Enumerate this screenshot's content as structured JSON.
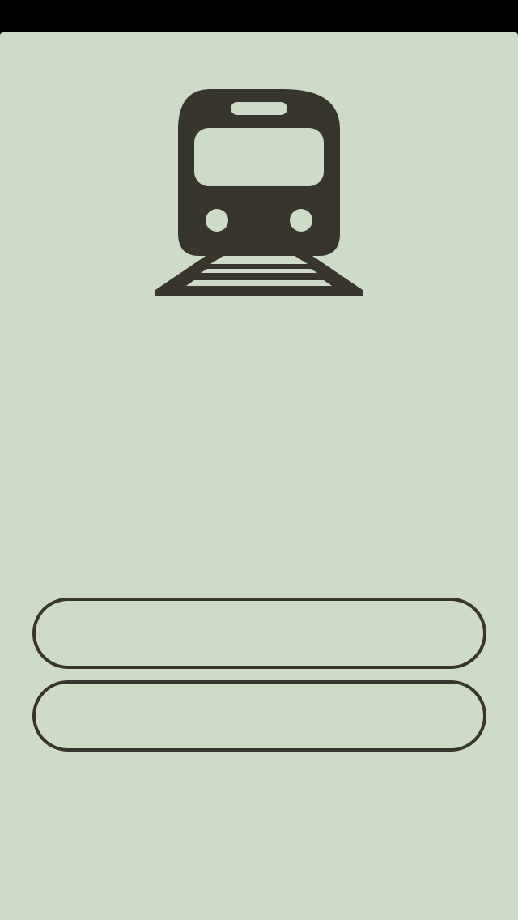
{
  "colors": {
    "status_bar": "#000000",
    "background": "#cddbc7",
    "ink": "#38352d"
  },
  "logo": {
    "icon": "train-icon"
  },
  "buttons": [
    {
      "label": ""
    },
    {
      "label": ""
    }
  ]
}
